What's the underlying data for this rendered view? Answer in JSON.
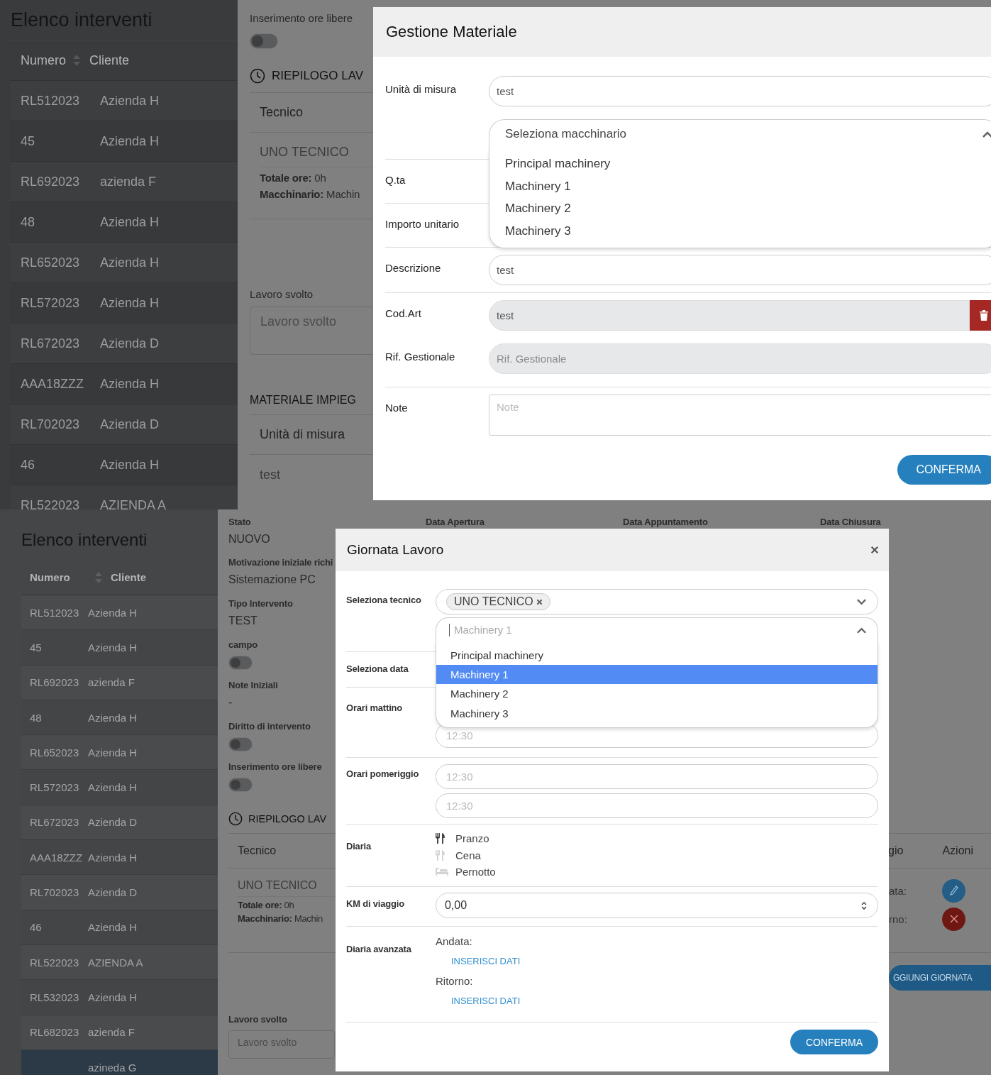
{
  "gestione_screen": {
    "list": {
      "title": "Elenco interventi",
      "columns": [
        "Numero",
        "Cliente"
      ],
      "rows": [
        {
          "numero": "RL512023",
          "cliente": "Azienda H",
          "selected": false
        },
        {
          "numero": "45",
          "cliente": "Azienda H",
          "selected": false
        },
        {
          "numero": "RL692023",
          "cliente": "azienda F",
          "selected": false
        },
        {
          "numero": "48",
          "cliente": "Azienda H",
          "selected": false
        },
        {
          "numero": "RL652023",
          "cliente": "Azienda H",
          "selected": false
        },
        {
          "numero": "RL572023",
          "cliente": "Azienda H",
          "selected": false
        },
        {
          "numero": "RL672023",
          "cliente": "Azienda D",
          "selected": false
        },
        {
          "numero": "AAA18ZZZ",
          "cliente": "Azienda H",
          "selected": false
        },
        {
          "numero": "RL702023",
          "cliente": "Azienda D",
          "selected": false
        },
        {
          "numero": "46",
          "cliente": "Azienda H",
          "selected": false
        },
        {
          "numero": "RL522023",
          "cliente": "AZIENDA A",
          "selected": false
        }
      ]
    },
    "detail": {
      "toggle": {
        "label": "Inserimento ore libere",
        "on": false
      },
      "summary": {
        "title": "RIEPILOGO LAV",
        "header": "Tecnico",
        "technician": "UNO TECNICO",
        "total_label": "Totale ore:",
        "total_value": "0h",
        "machine_label": "Macchinario:",
        "machine_value": "Machin"
      },
      "work": {
        "label": "Lavoro svolto",
        "placeholder": "Lavoro svolto"
      },
      "materials": {
        "title": "MATERIALE IMPIEG",
        "header": "Unità di misura",
        "value": "test"
      }
    },
    "modal": {
      "title": "Gestione Materiale",
      "unit": {
        "label": "Unità di misura",
        "value": "test"
      },
      "machine_select": {
        "placeholder": "Seleziona macchinario",
        "expanded": true,
        "options": [
          {
            "label": "Principal machinery",
            "selected": false
          },
          {
            "label": "Machinery 1",
            "selected": false
          },
          {
            "label": "Machinery 2",
            "selected": false
          },
          {
            "label": "Machinery 3",
            "selected": false
          }
        ]
      },
      "covered_rows": [
        "Q.ta",
        "Importo unitario"
      ],
      "description": {
        "label": "Descrizione",
        "value": "test"
      },
      "code": {
        "label": "Cod.Art",
        "value": "test",
        "disabled": true
      },
      "reference": {
        "label": "Rif. Gestionale",
        "placeholder": "Rif. Gestionale",
        "disabled": true
      },
      "note": {
        "label": "Note",
        "placeholder": "Note"
      },
      "confirm": "CONFERMA"
    }
  },
  "giornata_screen": {
    "list": {
      "title": "Elenco interventi",
      "columns": [
        "Numero",
        "Cliente"
      ],
      "rows": [
        {
          "numero": "RL512023",
          "cliente": "Azienda H",
          "selected": false
        },
        {
          "numero": "45",
          "cliente": "Azienda H",
          "selected": false
        },
        {
          "numero": "RL692023",
          "cliente": "azienda F",
          "selected": false
        },
        {
          "numero": "48",
          "cliente": "Azienda H",
          "selected": false
        },
        {
          "numero": "RL652023",
          "cliente": "Azienda H",
          "selected": false
        },
        {
          "numero": "RL572023",
          "cliente": "Azienda H",
          "selected": false
        },
        {
          "numero": "RL672023",
          "cliente": "Azienda D",
          "selected": false
        },
        {
          "numero": "AAA18ZZZ",
          "cliente": "Azienda H",
          "selected": false
        },
        {
          "numero": "RL702023",
          "cliente": "Azienda D",
          "selected": false
        },
        {
          "numero": "46",
          "cliente": "Azienda H",
          "selected": false
        },
        {
          "numero": "RL522023",
          "cliente": "AZIENDA A",
          "selected": false
        },
        {
          "numero": "RL532023",
          "cliente": "Azienda H",
          "selected": false
        },
        {
          "numero": "RL682023",
          "cliente": "azienda F",
          "selected": false
        },
        {
          "cliente": "azineda G",
          "selected": true
        }
      ]
    },
    "detail": {
      "headers": [
        {
          "label": "Stato",
          "value": "NUOVO"
        },
        {
          "label": "Data Apertura"
        },
        {
          "label": "Data Appuntamento"
        },
        {
          "label": "Data Chiusura"
        }
      ],
      "fields": [
        {
          "kind": "text",
          "label": "Motivazione iniziale richi",
          "value": "Sistemazione PC"
        },
        {
          "kind": "text",
          "label": "Tipo Intervento",
          "value": "TEST"
        },
        {
          "kind": "toggle",
          "label": "campo",
          "on": false
        },
        {
          "kind": "text",
          "label": "Note Iniziali",
          "value": "-"
        },
        {
          "kind": "toggle",
          "label": "Diritto di intervento",
          "on": false
        },
        {
          "kind": "toggle",
          "label": "Inserimento ore libere",
          "on": false
        }
      ],
      "summary": {
        "title": "RIEPILOGO LAV",
        "header": "Tecnico",
        "right_headers": [
          "gio",
          "Azioni"
        ],
        "technician": "UNO TECNICO",
        "total_label": "Totale ore:",
        "total_value": "0h",
        "machine_label": "Macchinario:",
        "machine_value": "Machin",
        "right_labels": [
          "ata:",
          "rno:"
        ]
      },
      "add_button": "GGIUNGI GIORNATA",
      "work": {
        "label": "Lavoro svolto",
        "placeholder": "Lavoro svolto"
      }
    },
    "modal": {
      "title": "Giornata Lavoro",
      "technician": {
        "label": "Seleziona tecnico",
        "tags": [
          "UNO TECNICO"
        ]
      },
      "machine_select": {
        "placeholder": "Machinery 1",
        "expanded": true,
        "options": [
          {
            "label": "Principal machinery",
            "selected": false
          },
          {
            "label": "Machinery 1",
            "selected": true
          },
          {
            "label": "Machinery 2",
            "selected": false
          },
          {
            "label": "Machinery 3",
            "selected": false
          }
        ]
      },
      "date_label": "Seleziona data",
      "morning": {
        "label": "Orari mattino",
        "placeholder": "12:30"
      },
      "afternoon": {
        "label": "Orari pomeriggio",
        "placeholders": [
          "12:30",
          "12:30"
        ]
      },
      "diaria": {
        "label": "Diaria",
        "items": [
          {
            "kind": "meal",
            "label": "Pranzo",
            "on": true
          },
          {
            "kind": "meal",
            "label": "Cena",
            "on": false
          },
          {
            "kind": "night",
            "label": "Pernotto",
            "on": false
          }
        ]
      },
      "km": {
        "label": "KM di viaggio",
        "value": "0,00"
      },
      "advanced": {
        "label": "Diaria avanzata",
        "entries": [
          {
            "label": "Andata:",
            "link": "INSERISCI DATI"
          },
          {
            "label": "Ritorno:",
            "link": "INSERISCI DATI"
          }
        ]
      },
      "confirm": "CONFERMA"
    }
  }
}
